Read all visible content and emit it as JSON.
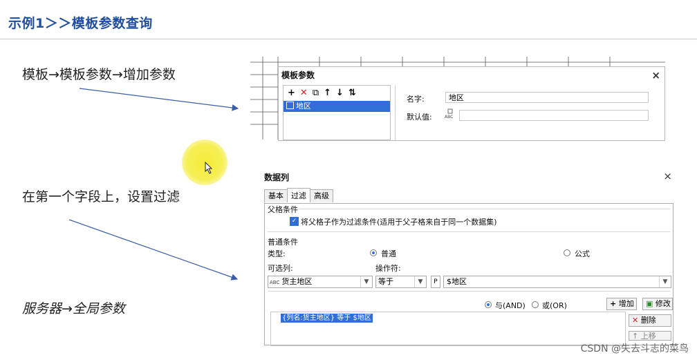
{
  "slide": {
    "title": "示例1＞＞模板参数查询",
    "step1": "模板→模板参数→增加参数",
    "step2": "在第一个字段上，设置过滤",
    "step3": "服务器→全局参数"
  },
  "template_param_dialog": {
    "title": "模板参数",
    "close": "×",
    "toolbar": [
      "add-icon",
      "delete-icon",
      "copy-icon",
      "up-arrow-icon",
      "down-arrow-icon",
      "sort-icon"
    ],
    "tree_item": "地区",
    "name_label": "名字:",
    "name_value": "地区",
    "default_label": "默认值:",
    "default_value": ""
  },
  "data_column_dialog": {
    "title": "数据列",
    "close": "×",
    "tabs": [
      "基本",
      "过滤",
      "高级"
    ],
    "active_tab": "过滤",
    "parent_condition_heading": "父格条件",
    "parent_checkbox_label": "将父格子作为过滤条件(适用于父子格来自于同一个数据集)",
    "common_condition_heading": "普通条件",
    "type_label": "类型:",
    "type_options": [
      "普通",
      "公式"
    ],
    "type_selected": "普通",
    "column_label": "可选列:",
    "column_value": "货主地区",
    "operator_label": "操作符:",
    "operator_value": "等于",
    "param_value": "$地区",
    "logic_and": "与(AND)",
    "logic_or": "或(OR)",
    "add_button": "增加",
    "modify_button": "修改",
    "delete_button": "删除",
    "moveup_button": "上移",
    "condition_row": "{列名:货主地区} 等于 $地区"
  },
  "watermark": "CSDN @失去斗志的菜鸟",
  "colors": {
    "title": "#1f4e9e",
    "arrow": "#3a5ea8",
    "selection": "#2f6fd6",
    "highlight": "#f4ec3a"
  }
}
